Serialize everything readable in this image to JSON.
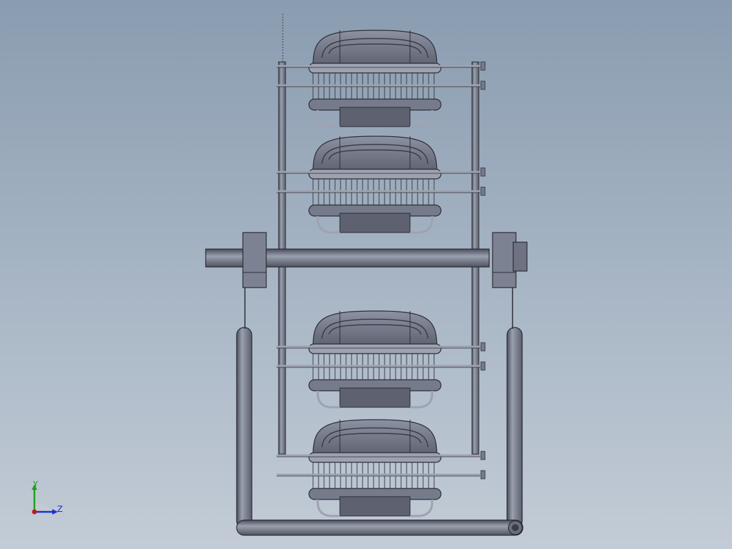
{
  "viewport": {
    "background_top": "#8a9cb0",
    "background_bottom": "#c3ccd6"
  },
  "model": {
    "part_fill": "#767b8c",
    "part_light": "#9ea2b0",
    "part_dark": "#3a3d48",
    "edge_color": "#2a2c35",
    "components": [
      "frame-rail-left",
      "frame-rail-right",
      "base-tube",
      "axle-shaft",
      "bearing-block-left",
      "bearing-block-right",
      "basket-top",
      "basket-upper-middle",
      "basket-lower-middle",
      "basket-bottom"
    ]
  },
  "triad": {
    "y_label": "Y",
    "z_label": "Z",
    "y_color": "#1aa31a",
    "z_color": "#1a2fd0",
    "x_color": "#c01818",
    "icon": "axis-triad-icon"
  }
}
